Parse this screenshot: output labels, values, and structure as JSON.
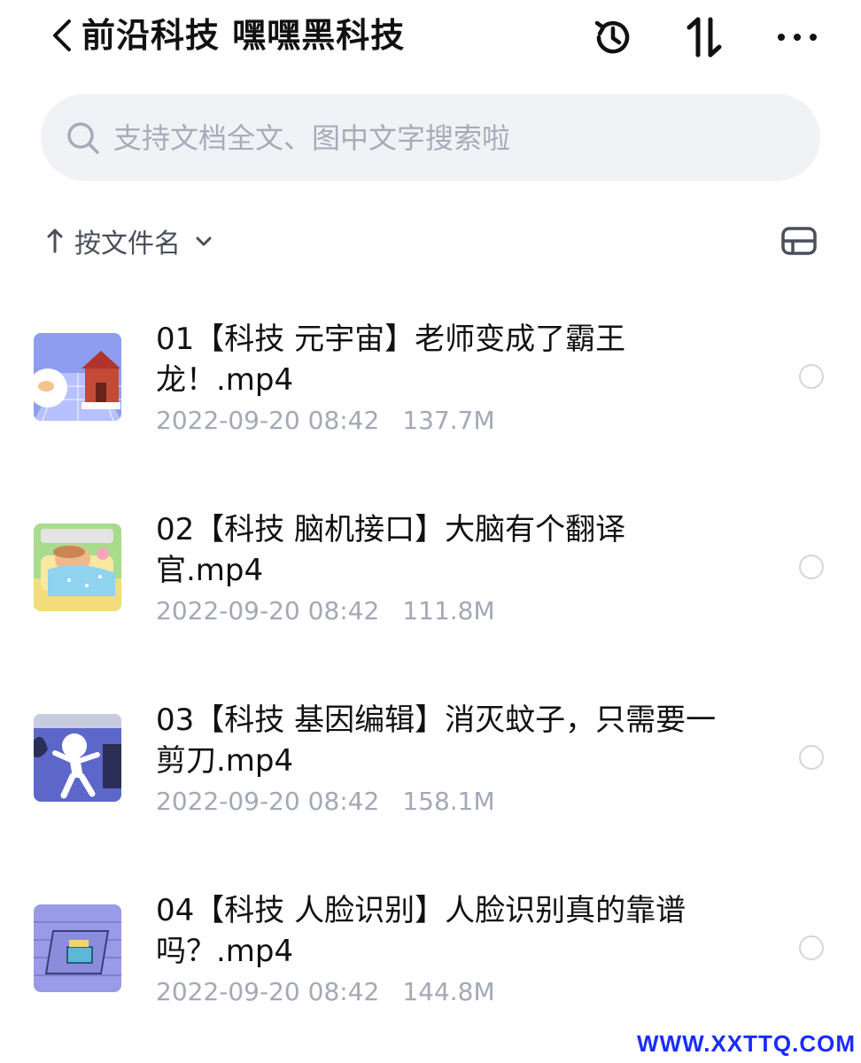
{
  "header": {
    "title": "前沿科技  嘿嘿黑科技",
    "icons": [
      "chevron-left-icon",
      "history-icon",
      "sort-arrows-icon",
      "more-icon"
    ]
  },
  "search": {
    "placeholder": "支持文档全文、图中文字搜索啦",
    "value": ""
  },
  "sortbar": {
    "label": "按文件名",
    "direction": "ascending"
  },
  "files": [
    {
      "name": "01【科技 元宇宙】老师变成了霸王龙！.mp4",
      "date": "2022-09-20 08:42",
      "size": "137.7M",
      "selected": false,
      "thumb_icon": "video-thumbnail-icon"
    },
    {
      "name": "02【科技 脑机接口】大脑有个翻译官.mp4",
      "date": "2022-09-20 08:42",
      "size": "111.8M",
      "selected": false,
      "thumb_icon": "video-thumbnail-icon"
    },
    {
      "name": "03【科技 基因编辑】消灭蚊子，只需要一剪刀.mp4",
      "date": "2022-09-20 08:42",
      "size": "158.1M",
      "selected": false,
      "thumb_icon": "video-thumbnail-icon"
    },
    {
      "name": "04【科技 人脸识别】人脸识别真的靠谱吗？.mp4",
      "date": "2022-09-20 08:42",
      "size": "144.8M",
      "selected": false,
      "thumb_icon": "video-thumbnail-icon"
    }
  ],
  "watermark": "WWW.XXTTQ.COM",
  "colors": {
    "text": "#111111",
    "meta": "#a3a9b5",
    "search_bg": "#f1f2f6",
    "watermark": "#1a2cff"
  }
}
